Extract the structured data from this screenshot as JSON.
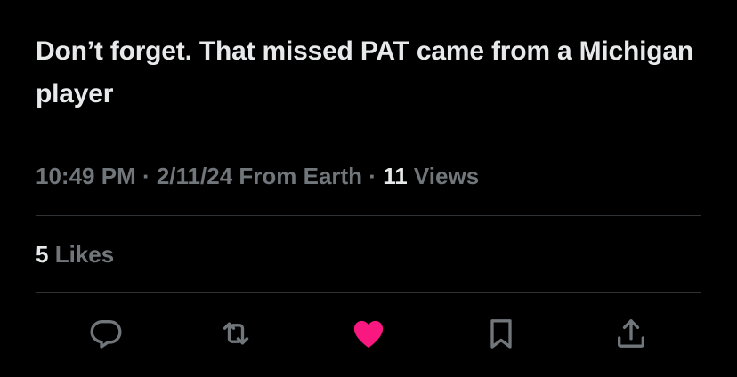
{
  "tweet": {
    "text": "Don’t forget. That missed PAT came from a Michigan player"
  },
  "meta": {
    "time": "10:49 PM",
    "sep1": " · ",
    "date": "2/11/24",
    "source": " From Earth",
    "sep2": " · ",
    "views_count": "11",
    "views_label": " Views"
  },
  "stats": {
    "likes_count": "5",
    "likes_label": " Likes"
  },
  "actions": [
    {
      "icon": "reply-icon"
    },
    {
      "icon": "retweet-icon"
    },
    {
      "icon": "heart-icon",
      "active": true
    },
    {
      "icon": "bookmark-icon"
    },
    {
      "icon": "share-icon"
    }
  ],
  "colors": {
    "background": "#000000",
    "text_primary": "#e7e9ea",
    "text_secondary": "#71767b",
    "divider": "#2f3336",
    "like_active": "#f91880"
  }
}
